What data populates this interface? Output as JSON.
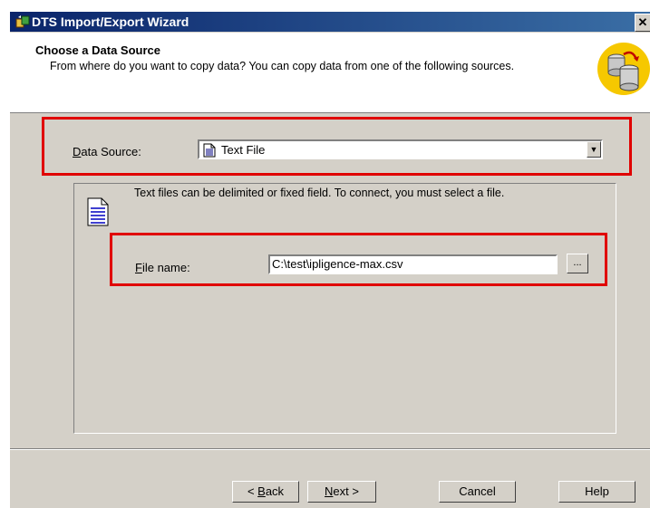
{
  "window": {
    "title": "DTS Import/Export Wizard",
    "close_glyph": "✕"
  },
  "header": {
    "title": "Choose a Data Source",
    "description": "From where do you want to copy data? You can copy data from one of the following sources.",
    "icon": "database-copy-icon"
  },
  "data_source": {
    "label_accel": "D",
    "label_rest": "ata Source:",
    "selected": "Text File",
    "dropdown_glyph": "▼"
  },
  "text_file_group": {
    "description": "Text files can be delimited or fixed field. To connect, you must select a file.",
    "file_name_label_accel": "F",
    "file_name_label_rest": "ile name:",
    "file_name_value": "C:\\test\\ipligence-max.csv",
    "browse_label": "..."
  },
  "buttons": {
    "back_prefix": "< ",
    "back_accel": "B",
    "back_rest": "ack",
    "next_accel": "N",
    "next_rest": "ext >",
    "cancel": "Cancel",
    "help": "Help"
  },
  "colors": {
    "highlight": "#e00000",
    "titlebar": "#0a246a",
    "dialog": "#d4d0c8"
  }
}
